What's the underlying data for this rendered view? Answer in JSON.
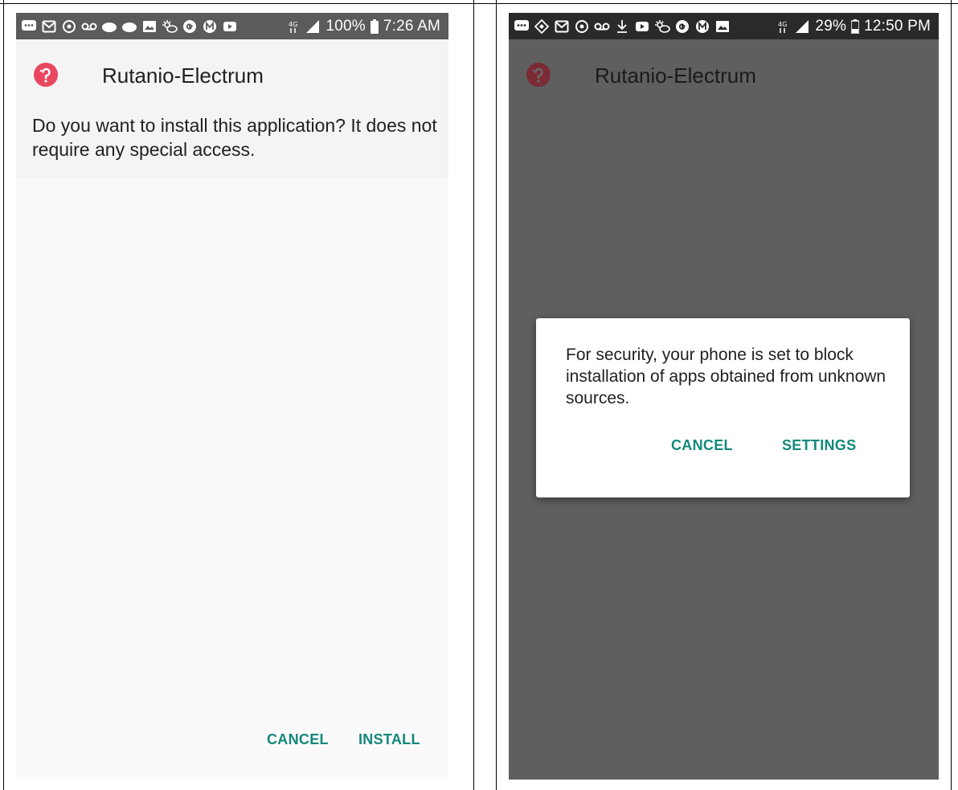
{
  "left_screen": {
    "statusbar": {
      "icons": [
        "chat-icon",
        "mail-icon",
        "sync-icon",
        "voicemail-icon",
        "cloud-icon",
        "cloud-icon",
        "gallery-icon",
        "weather-icon",
        "google-icon",
        "m-app-icon",
        "youtube-icon"
      ],
      "signal_label": "4G",
      "battery_label": "100%",
      "time": "7:26 AM"
    },
    "header": {
      "app_name": "Rutanio-Electrum",
      "question": "Do you want to install this application? It does not require any special access."
    },
    "buttons": {
      "cancel_label": "CANCEL",
      "install_label": "INSTALL"
    }
  },
  "right_screen": {
    "statusbar": {
      "icons": [
        "chat-icon",
        "binance-icon",
        "mail-icon",
        "sync-icon",
        "voicemail-icon",
        "download-icon",
        "youtube-icon",
        "weather-icon",
        "google-icon",
        "m-app-icon",
        "gallery-icon"
      ],
      "signal_label": "4G",
      "battery_label": "29%",
      "time": "12:50 PM"
    },
    "header": {
      "app_name": "Rutanio-Electrum"
    },
    "dialog": {
      "message": "For security, your phone is set to block installation of apps obtained from unknown sources.",
      "cancel_label": "CANCEL",
      "settings_label": "SETTINGS"
    }
  },
  "colors": {
    "accent": "#13897a",
    "logo": "#e8475e",
    "dim_overlay": "#5f5f5f"
  }
}
